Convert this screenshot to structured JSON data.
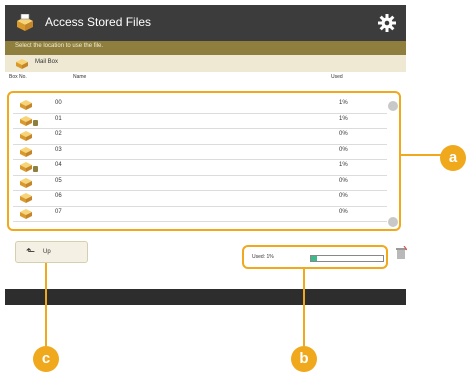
{
  "titlebar": {
    "title": "Access Stored Files"
  },
  "instruction": "Select the location to use the file.",
  "mail_box": {
    "label": "Mail Box"
  },
  "columns": {
    "box_no": "Box No.",
    "name": "Name",
    "used": "Used"
  },
  "rows": [
    {
      "no": "00",
      "used": "1%"
    },
    {
      "no": "01",
      "used": "1%"
    },
    {
      "no": "02",
      "used": "0%"
    },
    {
      "no": "03",
      "used": "0%"
    },
    {
      "no": "04",
      "used": "1%"
    },
    {
      "no": "05",
      "used": "0%"
    },
    {
      "no": "06",
      "used": "0%"
    },
    {
      "no": "07",
      "used": "0%"
    }
  ],
  "up_button": {
    "label": "Up"
  },
  "used_status": {
    "label": "Used:",
    "value": "1%",
    "fill_fraction": 0.08
  },
  "markers": {
    "a": "a",
    "b": "b",
    "c": "c"
  },
  "colors": {
    "accent": "#f0a81c",
    "header": "#3c3c3c",
    "band": "#8e7f3e",
    "gauge": "#3cba8a"
  }
}
